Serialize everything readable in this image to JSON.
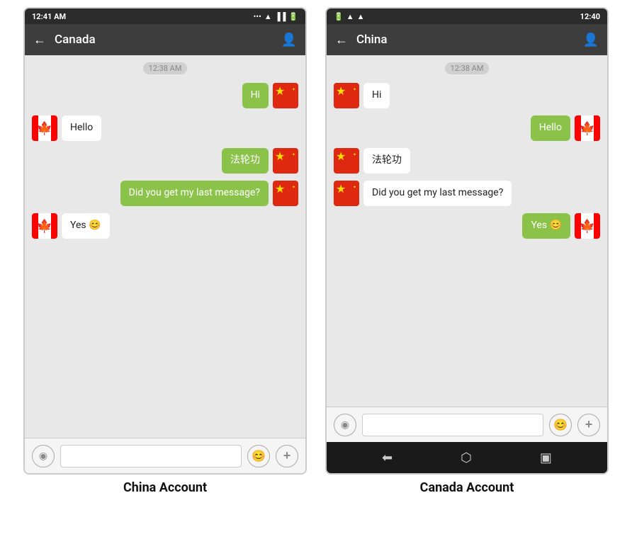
{
  "phones": [
    {
      "id": "china-account-phone",
      "statusBar": {
        "time": "12:41 AM",
        "icons": "... ☁ ▲ ▐▐ 🔋"
      },
      "navBar": {
        "back": "←",
        "title": "Canada",
        "profileIcon": "👤"
      },
      "messages": [
        {
          "type": "timestamp",
          "text": "12:38 AM"
        },
        {
          "type": "sent",
          "flag": "china",
          "text": "Hi"
        },
        {
          "type": "received",
          "flag": "canada",
          "text": "Hello"
        },
        {
          "type": "sent",
          "flag": "china",
          "text": "法轮功"
        },
        {
          "type": "sent",
          "flag": "china",
          "text": "Did you get my last message?"
        },
        {
          "type": "received",
          "flag": "canada",
          "text": "Yes 😊"
        }
      ],
      "inputBar": {
        "voiceIcon": "◉",
        "placeholder": "",
        "emojiIcon": "😊",
        "plusIcon": "+"
      },
      "hasAndroidNav": false
    },
    {
      "id": "canada-account-phone",
      "statusBar": {
        "time": "12:40",
        "icons": "🔋 ▲ ☁ ..."
      },
      "navBar": {
        "back": "←",
        "title": "China",
        "profileIcon": "👤"
      },
      "messages": [
        {
          "type": "timestamp",
          "text": "12:38 AM"
        },
        {
          "type": "received",
          "flag": "china",
          "text": "Hi"
        },
        {
          "type": "sent",
          "flag": "canada",
          "text": "Hello"
        },
        {
          "type": "received",
          "flag": "china",
          "text": "法轮功"
        },
        {
          "type": "received",
          "flag": "china",
          "text": "Did you get my last message?"
        },
        {
          "type": "sent",
          "flag": "canada",
          "text": "Yes 😊"
        }
      ],
      "inputBar": {
        "voiceIcon": "◉",
        "placeholder": "",
        "emojiIcon": "😊",
        "plusIcon": "+"
      },
      "hasAndroidNav": true,
      "androidNav": {
        "back": "⬅",
        "home": "⬡",
        "recents": "▣"
      }
    }
  ],
  "captions": [
    "China Account",
    "Canada Account"
  ]
}
